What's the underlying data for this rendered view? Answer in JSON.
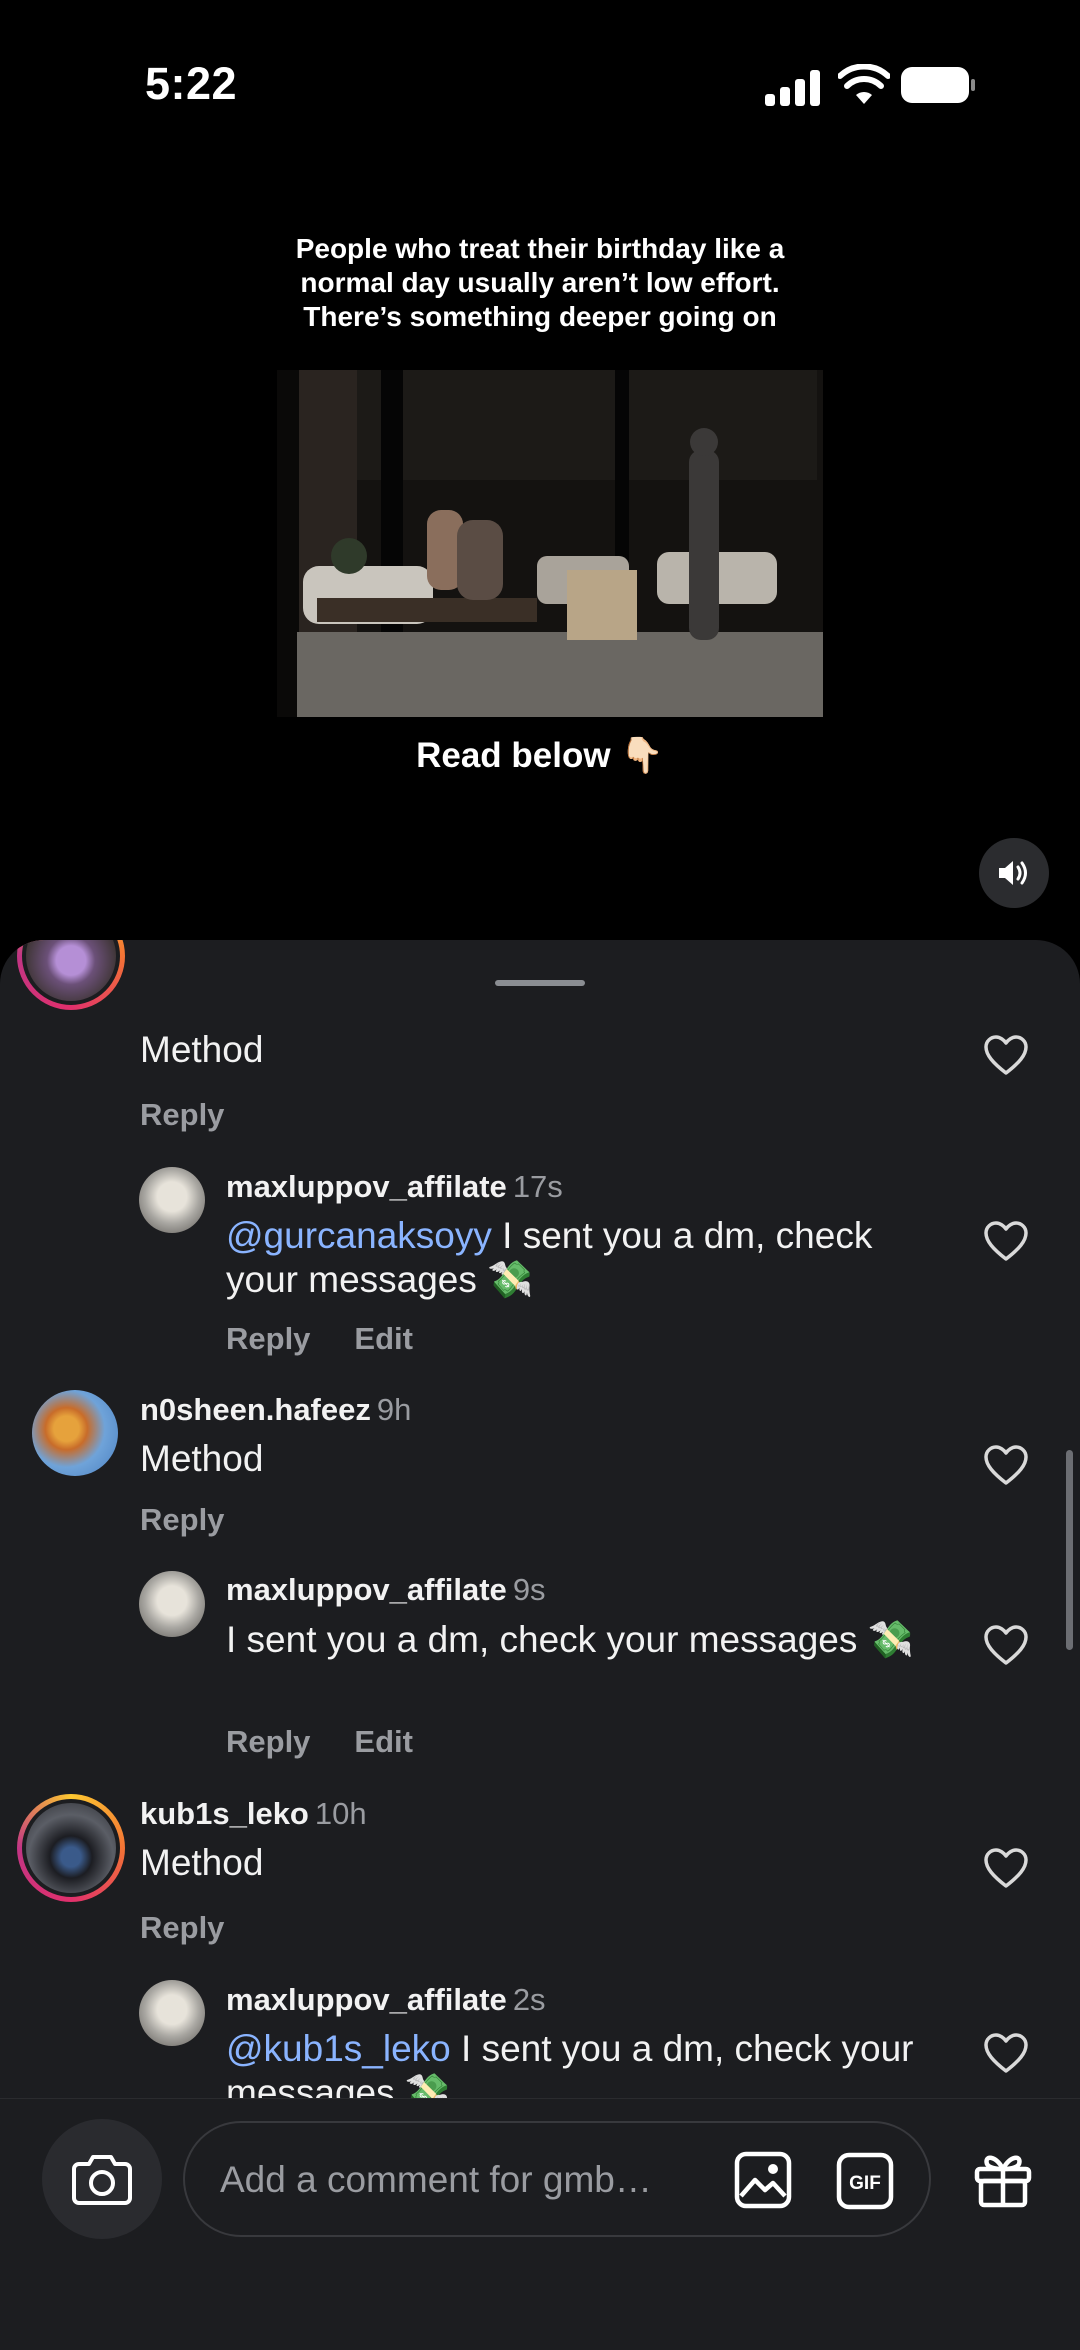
{
  "status_bar": {
    "time": "5:22"
  },
  "story": {
    "caption_lines": [
      "People who treat their birthday like a",
      "normal day usually aren’t low effort.",
      "There’s something deeper going on"
    ],
    "read_below": "Read below 👇🏻"
  },
  "comments": [
    {
      "username": "",
      "time": "",
      "text": "Method",
      "actions": [
        "Reply"
      ]
    },
    {
      "username": "maxluppov_affilate",
      "time": "17s",
      "mention": "@gurcanaksoyy",
      "text": " I sent you a dm, check your messages 💸",
      "actions": [
        "Reply",
        "Edit"
      ]
    },
    {
      "username": "n0sheen.hafeez",
      "time": "9h",
      "text": "Method",
      "actions": [
        "Reply"
      ]
    },
    {
      "username": "maxluppov_affilate",
      "time": "9s",
      "text": "I sent you a dm, check your messages 💸",
      "actions": [
        "Reply",
        "Edit"
      ]
    },
    {
      "username": "kub1s_leko",
      "time": "10h",
      "text": "Method",
      "actions": [
        "Reply"
      ]
    },
    {
      "username": "maxluppov_affilate",
      "time": "2s",
      "mention": "@kub1s_leko",
      "text": " I sent you a dm, check your messages 💸",
      "actions": []
    }
  ],
  "composer": {
    "placeholder": "Add a comment for gmb…",
    "gif_label": "GIF"
  },
  "colors": {
    "sheet_bg": "#1c1d20",
    "mention": "#8ab4ff",
    "muted": "#9a9ca1"
  }
}
